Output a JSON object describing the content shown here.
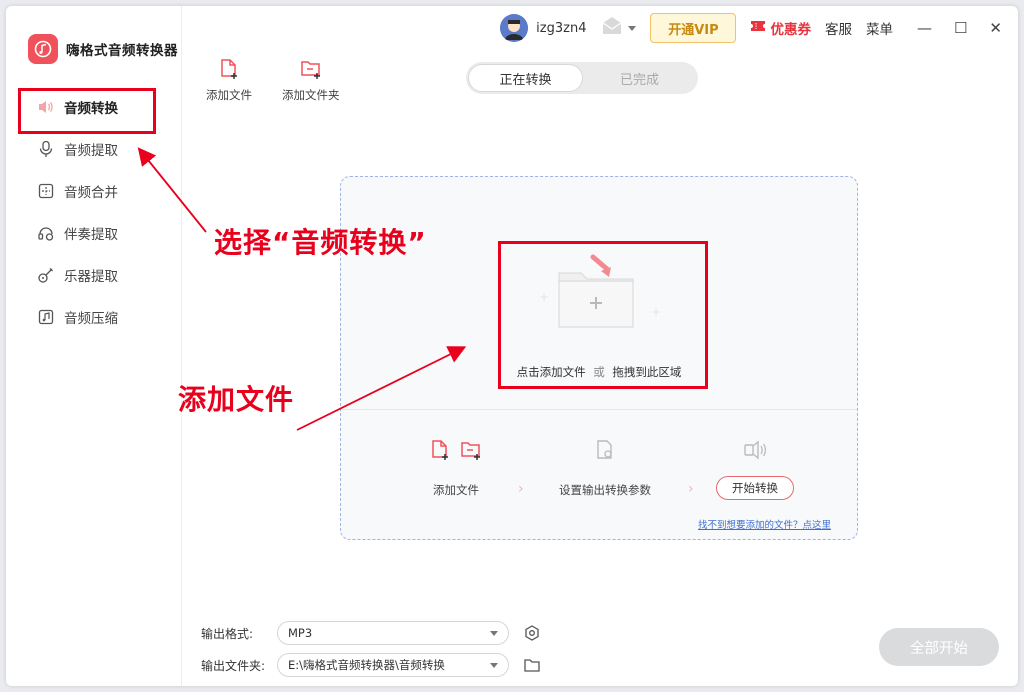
{
  "app": {
    "title": "嗨格式音频转换器"
  },
  "sidebar": {
    "items": [
      {
        "label": "音频转换",
        "icon": "speaker-icon",
        "active": true
      },
      {
        "label": "音频提取",
        "icon": "microphone-icon"
      },
      {
        "label": "音频合并",
        "icon": "merge-icon"
      },
      {
        "label": "伴奏提取",
        "icon": "headset-icon"
      },
      {
        "label": "乐器提取",
        "icon": "guitar-icon"
      },
      {
        "label": "音频压缩",
        "icon": "compress-icon"
      }
    ]
  },
  "topbar": {
    "username": "izg3zn4",
    "vip_label": "开通VIP",
    "coupon_label": "优惠券",
    "service_label": "客服",
    "menu_label": "菜单"
  },
  "toolbar": {
    "add_file": "添加文件",
    "add_folder": "添加文件夹"
  },
  "tabs": [
    {
      "label": "正在转换",
      "active": true
    },
    {
      "label": "已完成",
      "active": false
    }
  ],
  "dropzone": {
    "hint_click": "点击添加文件",
    "hint_or": "或",
    "hint_drag": "拖拽到此区域",
    "steps": {
      "add": "添加文件",
      "settings": "设置输出转换参数",
      "start": "开始转换"
    },
    "help_link": "找不到想要添加的文件？点这里"
  },
  "footer": {
    "format_label": "输出格式:",
    "format_value": "MP3",
    "folder_label": "输出文件夹:",
    "folder_value": "E:\\嗨格式音频转换器\\音频转换",
    "start_all": "全部开始"
  },
  "annotations": {
    "select_note": "选择“音频转换”",
    "add_note": "添加文件"
  },
  "colors": {
    "accent": "#f0525b",
    "annotation": "#e8001c",
    "link": "#3d6fd1"
  }
}
